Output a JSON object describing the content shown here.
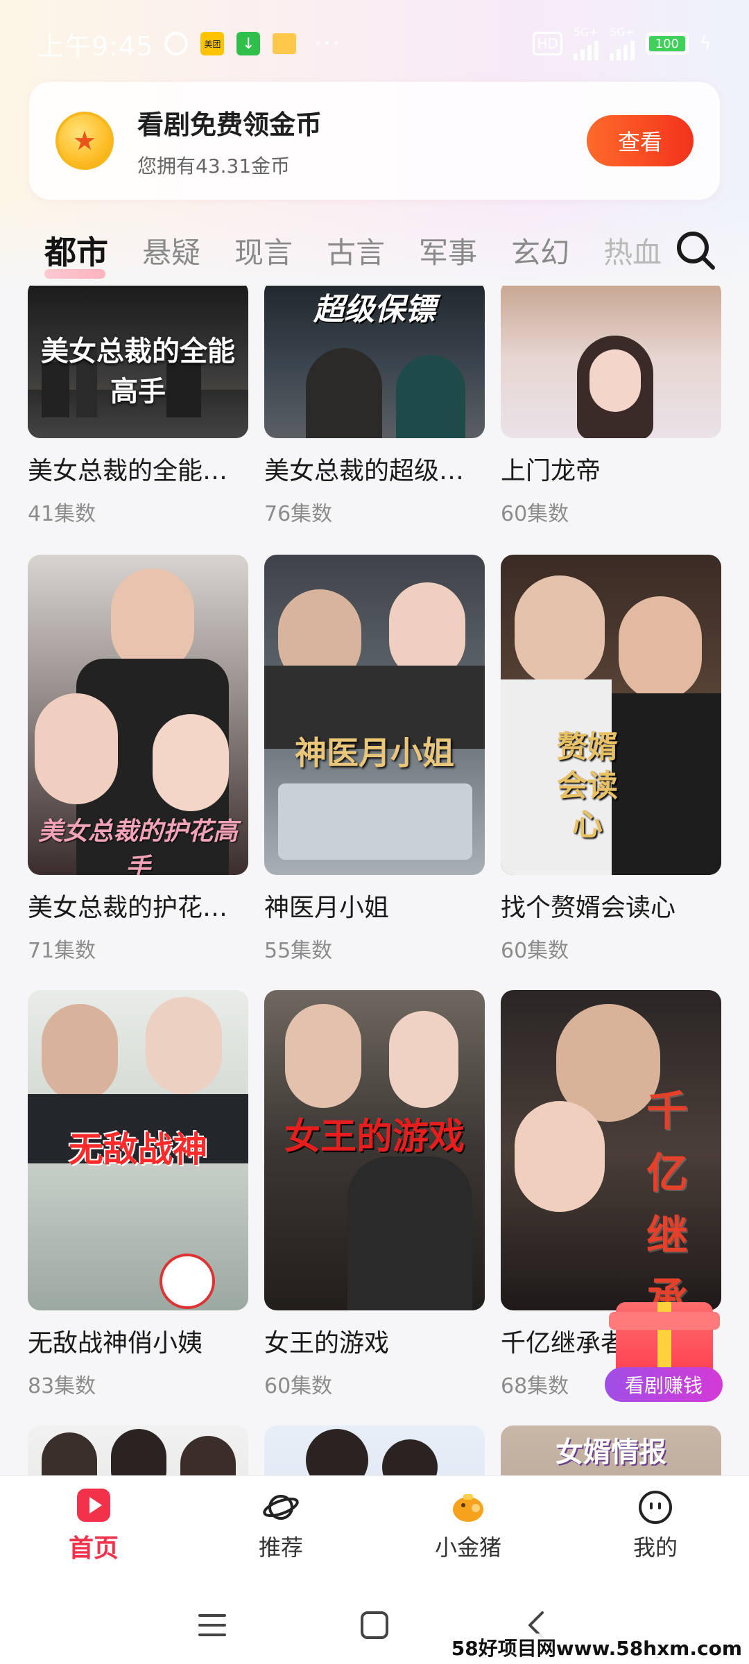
{
  "status_bar": {
    "time": "上午9:45",
    "hd": "HD",
    "net1": "5G+",
    "net2": "5G+",
    "battery": "100"
  },
  "coin_banner": {
    "title": "看剧免费领金币",
    "subtitle": "您拥有43.31金币",
    "button": "查看"
  },
  "tabs": [
    "都市",
    "悬疑",
    "现言",
    "古言",
    "军事",
    "玄幻",
    "热血"
  ],
  "active_tab": "都市",
  "dramas": [
    {
      "title": "美女总裁的全能…",
      "episodes": "41集数",
      "poster_text": "美女总裁的全能高手"
    },
    {
      "title": "美女总裁的超级…",
      "episodes": "76集数",
      "poster_text": "超级保镖"
    },
    {
      "title": "上门龙帝",
      "episodes": "60集数",
      "poster_text": ""
    },
    {
      "title": "美女总裁的护花…",
      "episodes": "71集数",
      "poster_text": "美女总裁的护花高手"
    },
    {
      "title": "神医月小姐",
      "episodes": "55集数",
      "poster_text": "神医月小姐"
    },
    {
      "title": "找个赘婿会读心",
      "episodes": "60集数",
      "poster_text": "赘婿会读心"
    },
    {
      "title": "无敌战神俏小姨",
      "episodes": "83集数",
      "poster_text": "无敌战神"
    },
    {
      "title": "女王的游戏",
      "episodes": "60集数",
      "poster_text": "女王的游戏"
    },
    {
      "title": "千亿继承者",
      "episodes": "68集数",
      "poster_text": "千亿继承"
    },
    {
      "title": "",
      "episodes": "",
      "poster_text": ""
    },
    {
      "title": "",
      "episodes": "",
      "poster_text": ""
    },
    {
      "title": "",
      "episodes": "",
      "poster_text": "女婿情报"
    }
  ],
  "reward": {
    "label": "看剧赚钱"
  },
  "bottom_nav": [
    {
      "label": "首页",
      "icon": "play-icon",
      "active": true
    },
    {
      "label": "推荐",
      "icon": "planet-icon",
      "active": false
    },
    {
      "label": "小金猪",
      "icon": "piggy-icon",
      "active": false
    },
    {
      "label": "我的",
      "icon": "smiley-icon",
      "active": false
    }
  ],
  "watermark": "58好项目网www.58hxm.com",
  "colors": {
    "accent": "#f2324a",
    "button": "#f2331c",
    "coin": "#ffc12e"
  }
}
